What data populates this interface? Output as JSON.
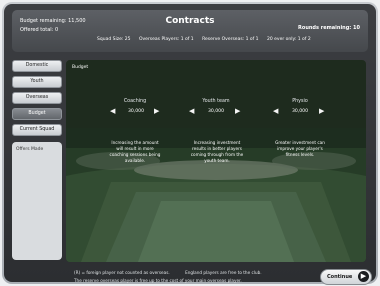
{
  "header": {
    "title": "Contracts",
    "budget_remaining": "Budget remaining: 11,500",
    "offered_total": "Offered total: 0",
    "rounds_remaining": "Rounds remaining: 10",
    "squad_size": "Squad Size: 25",
    "overseas_players": "Overseas Players: 1 of 1",
    "reserve_overseas": "Reserve Overseas: 1 of 1",
    "age_limit": "20 ever only: 1 of 2"
  },
  "sidebar": {
    "items": [
      {
        "label": "Domestic"
      },
      {
        "label": "Youth"
      },
      {
        "label": "Overseas"
      },
      {
        "label": "Budget"
      },
      {
        "label": "Current Squad"
      }
    ],
    "offers_made": "Offers Made"
  },
  "panel": {
    "title": "Budget",
    "controls": [
      {
        "label": "Coaching",
        "value": "30,000",
        "description": "Increasing the amount will result in more coaching sessions being available."
      },
      {
        "label": "Youth team",
        "value": "30,000",
        "description": "Increasing investment results in better players coming through from the youth team."
      },
      {
        "label": "Physio",
        "value": "30,000",
        "description": "Greater investment can improve your player's fitness levels."
      }
    ]
  },
  "footer": {
    "line1": "(R) = foreign player not counted as overseas.",
    "line1b": "England players are free to the club.",
    "line2": "The reserve overseas player is free up to the cost of your main overseas player.",
    "continue_label": "Continue"
  },
  "icons": {
    "left_arrow": "◀",
    "right_arrow": "▶",
    "continue_icon": "▶"
  }
}
